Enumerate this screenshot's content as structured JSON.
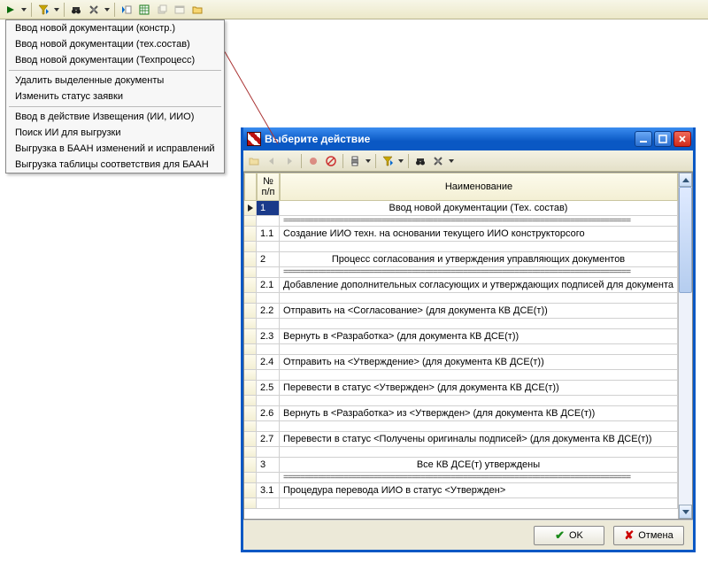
{
  "menu": {
    "items": [
      "Ввод новой документации (констр.)",
      "Ввод новой документации (тех.состав)",
      "Ввод новой документации (Техпроцесс)",
      "Удалить выделенные документы",
      "Изменить статус заявки",
      "Ввод в действие Извещения (ИИ, ИИО)",
      "Поиск ИИ для выгрузки",
      "Выгрузка в БААН изменений и исправлений",
      "Выгрузка таблицы соответствия для БААН"
    ]
  },
  "dialog": {
    "title": "Выберите действие",
    "col_num": "№\nп/п",
    "col_name": "Наименование",
    "ok_label": "OK",
    "cancel_label": "Отмена",
    "rows": [
      {
        "n": "1",
        "t": "Ввод новой документации (Тех. состав)",
        "center": true
      },
      {
        "n": "1.1",
        "t": "Создание ИИО техн. на основании текущего ИИО конструкторсого"
      },
      {
        "n": "2",
        "t": "Процесс согласования и утверждения управляющих документов",
        "center": true
      },
      {
        "n": "2.1",
        "t": "Добавление дополнительных согласующих и утверждающих подписей для документа КВ ДСЕ(т)"
      },
      {
        "n": "2.2",
        "t": "Отправить на <Согласование> (для документа КВ ДСЕ(т))"
      },
      {
        "n": "2.3",
        "t": "Вернуть в <Разработка> (для документа КВ ДСЕ(т))"
      },
      {
        "n": "2.4",
        "t": "Отправить на <Утверждение> (для документа КВ ДСЕ(т))"
      },
      {
        "n": "2.5",
        "t": "Перевести в статус <Утвержден> (для документа КВ ДСЕ(т))"
      },
      {
        "n": "2.6",
        "t": "Вернуть в <Разработка> из <Утвержден> (для документа КВ ДСЕ(т))"
      },
      {
        "n": "2.7",
        "t": "Перевести в статус <Получены оригиналы подписей> (для документа КВ ДСЕ(т))"
      },
      {
        "n": "3",
        "t": "Все КВ ДСЕ(т) утверждены",
        "center": true
      },
      {
        "n": "3.1",
        "t": "Процедура перевода ИИО в статус <Утвержден>"
      }
    ],
    "sep": "================================================================================="
  }
}
